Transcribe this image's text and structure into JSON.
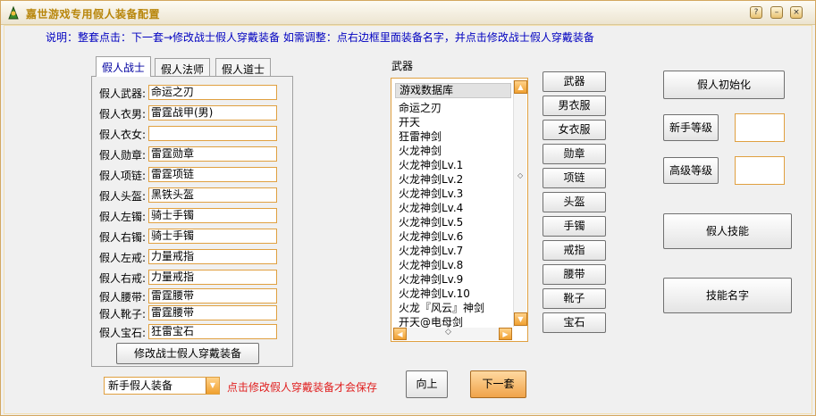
{
  "window": {
    "title": "嘉世游戏专用假人装备配置"
  },
  "hint": "说明：整套点击：下一套→修改战士假人穿戴装备   如需调整：点右边框里面装备名字，并点击修改战士假人穿戴装备",
  "tabs": [
    {
      "label": "假人战士",
      "active": true
    },
    {
      "label": "假人法师",
      "active": false
    },
    {
      "label": "假人道士",
      "active": false
    }
  ],
  "equipment": [
    {
      "label": "假人武器:",
      "value": "命运之刃"
    },
    {
      "label": "假人衣男:",
      "value": "雷霆战甲(男)"
    },
    {
      "label": "假人衣女:",
      "value": ""
    },
    {
      "label": "假人勋章:",
      "value": "雷霆勋章"
    },
    {
      "label": "假人项链:",
      "value": "雷霆项链"
    },
    {
      "label": "假人头盔:",
      "value": "黑铁头盔"
    },
    {
      "label": "假人左镯:",
      "value": "骑士手镯"
    },
    {
      "label": "假人右镯:",
      "value": "骑士手镯"
    },
    {
      "label": "假人左戒:",
      "value": "力量戒指"
    },
    {
      "label": "假人右戒:",
      "value": "力量戒指"
    },
    {
      "label": "假人腰带:",
      "value": "雷霆腰带"
    },
    {
      "label": "假人靴子:",
      "value": "雷霆腰带"
    },
    {
      "label": "假人宝石:",
      "value": "狂雷宝石"
    }
  ],
  "modify_button": "修改战士假人穿戴装备",
  "list": {
    "label": "武器",
    "header": "游戏数据库",
    "items": [
      "命运之刃",
      "开天",
      "狂雷神剑",
      "火龙神剑",
      "火龙神剑Lv.1",
      "火龙神剑Lv.2",
      "火龙神剑Lv.3",
      "火龙神剑Lv.4",
      "火龙神剑Lv.5",
      "火龙神剑Lv.6",
      "火龙神剑Lv.7",
      "火龙神剑Lv.8",
      "火龙神剑Lv.9",
      "火龙神剑Lv.10",
      "火龙『风云』神剑",
      "开天@电母剑"
    ]
  },
  "categories": [
    "武器",
    "男衣服",
    "女衣服",
    "勋章",
    "项链",
    "头盔",
    "手镯",
    "戒指",
    "腰带",
    "靴子",
    "宝石"
  ],
  "right": {
    "init_button": "假人初始化",
    "novice_level_button": "新手等级",
    "novice_level_value": "",
    "advanced_level_button": "高级等级",
    "advanced_level_value": "",
    "skills_button": "假人技能",
    "skill_names_button": "技能名字"
  },
  "bottom": {
    "preset_value": "新手假人装备",
    "note": "点击修改假人穿戴装备才会保存",
    "up_button": "向上",
    "next_button": "下一套"
  },
  "colors": {
    "accent": "#e0a040",
    "hint_text": "#0000c0",
    "note_text": "#e02020",
    "title_text": "#b8860b"
  }
}
